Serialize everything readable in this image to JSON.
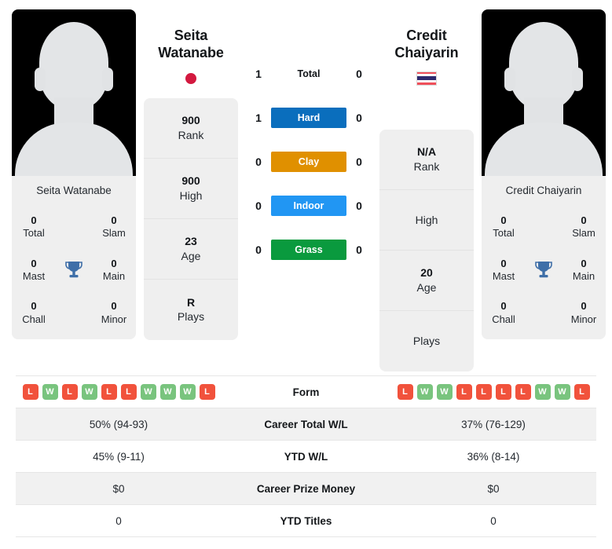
{
  "players": {
    "left": {
      "name": "Seita Watanabe",
      "name_line1": "Seita",
      "name_line2": "Watanabe",
      "flag": "japan-flag-icon",
      "card_name": "Seita Watanabe",
      "titles": [
        {
          "value": "0",
          "label": "Total"
        },
        {
          "value": "0",
          "label": "Slam"
        },
        {
          "value": "0",
          "label": "Mast"
        },
        {
          "value": "0",
          "label": "Main"
        },
        {
          "value": "0",
          "label": "Chall"
        },
        {
          "value": "0",
          "label": "Minor"
        }
      ],
      "profile": [
        {
          "value": "900",
          "label": "Rank"
        },
        {
          "value": "900",
          "label": "High"
        },
        {
          "value": "23",
          "label": "Age"
        },
        {
          "value": "R",
          "label": "Plays"
        }
      ],
      "form": [
        "L",
        "W",
        "L",
        "W",
        "L",
        "L",
        "W",
        "W",
        "W",
        "L"
      ],
      "career_total_wl": "50% (94-93)",
      "ytd_wl": "45% (9-11)",
      "career_prize_money": "$0",
      "ytd_titles": "0"
    },
    "right": {
      "name": "Credit Chaiyarin",
      "name_line1": "Credit",
      "name_line2": "Chaiyarin",
      "flag": "thailand-flag-icon",
      "card_name": "Credit Chaiyarin",
      "titles": [
        {
          "value": "0",
          "label": "Total"
        },
        {
          "value": "0",
          "label": "Slam"
        },
        {
          "value": "0",
          "label": "Mast"
        },
        {
          "value": "0",
          "label": "Main"
        },
        {
          "value": "0",
          "label": "Chall"
        },
        {
          "value": "0",
          "label": "Minor"
        }
      ],
      "profile": [
        {
          "value": "N/A",
          "label": "Rank"
        },
        {
          "value": "",
          "label": "High"
        },
        {
          "value": "20",
          "label": "Age"
        },
        {
          "value": "",
          "label": "Plays"
        }
      ],
      "form": [
        "L",
        "W",
        "W",
        "L",
        "L",
        "L",
        "L",
        "W",
        "W",
        "L"
      ],
      "career_total_wl": "37% (76-129)",
      "ytd_wl": "36% (8-14)",
      "career_prize_money": "$0",
      "ytd_titles": "0"
    }
  },
  "surfaces": [
    {
      "label": "Total",
      "left": "1",
      "right": "0",
      "style": "plain",
      "color": ""
    },
    {
      "label": "Hard",
      "left": "1",
      "right": "0",
      "style": "hard",
      "color": "#0a6ebd"
    },
    {
      "label": "Clay",
      "left": "0",
      "right": "0",
      "style": "clay",
      "color": "#e09000"
    },
    {
      "label": "Indoor",
      "left": "0",
      "right": "0",
      "style": "indoor",
      "color": "#2196f3"
    },
    {
      "label": "Grass",
      "left": "0",
      "right": "0",
      "style": "grass",
      "color": "#0a9a3e"
    }
  ],
  "stats_table": {
    "rows": [
      {
        "label": "Form",
        "key": "form"
      },
      {
        "label": "Career Total W/L",
        "key": "career_total_wl"
      },
      {
        "label": "YTD W/L",
        "key": "ytd_wl"
      },
      {
        "label": "Career Prize Money",
        "key": "career_prize_money"
      },
      {
        "label": "YTD Titles",
        "key": "ytd_titles"
      }
    ],
    "labels": {
      "form": "Form",
      "career_total_wl": "Career Total W/L",
      "ytd_wl": "YTD W/L",
      "career_prize_money": "Career Prize Money",
      "ytd_titles": "YTD Titles"
    }
  },
  "icons": {
    "trophy": "trophy-icon"
  },
  "colors": {
    "win_badge": "#79c47e",
    "loss_badge": "#f1523c",
    "hard": "#0a6ebd",
    "clay": "#e09000",
    "indoor": "#2196f3",
    "grass": "#0a9a3e"
  }
}
